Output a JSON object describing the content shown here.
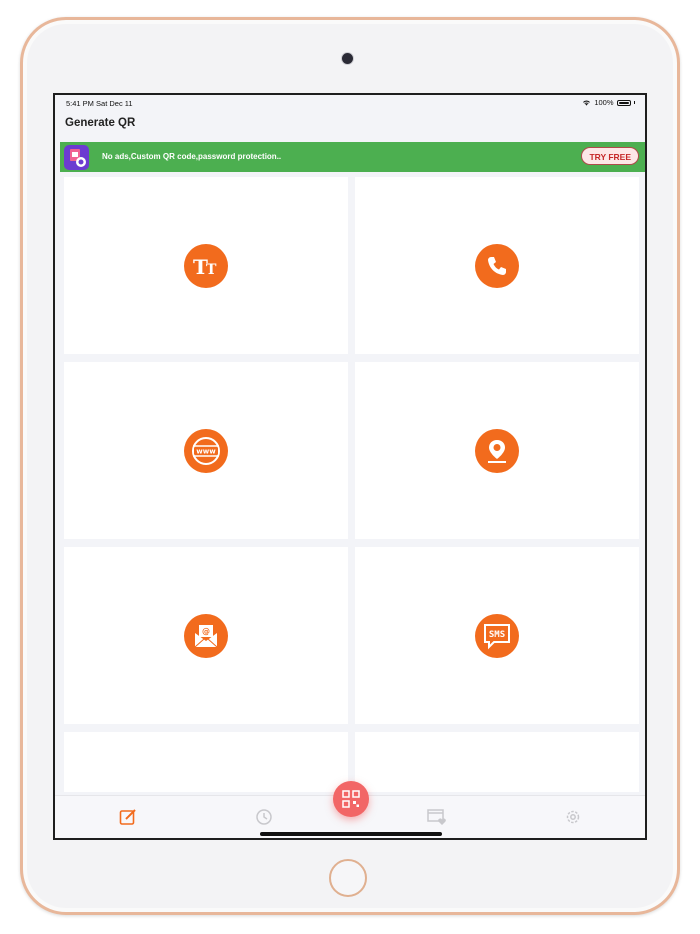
{
  "status": {
    "time_date": "5:41 PM   Sat Dec 11",
    "battery": "100%"
  },
  "header": {
    "title": "Generate QR"
  },
  "promo": {
    "text": "No ads,Custom QR code,password protection..",
    "button": "TRY FREE"
  },
  "grid": {
    "items": [
      {
        "icon": "text-icon",
        "label": "Tт"
      },
      {
        "icon": "phone-icon"
      },
      {
        "icon": "website-icon",
        "label": "www"
      },
      {
        "icon": "location-icon"
      },
      {
        "icon": "email-icon"
      },
      {
        "icon": "sms-icon",
        "label": "SMS"
      }
    ]
  },
  "tabbar": {
    "tabs": [
      "create-icon",
      "history-icon",
      "qr-scan-icon",
      "favorites-icon",
      "settings-icon"
    ],
    "active": "create-icon"
  },
  "colors": {
    "accent": "#f26b1d",
    "promo": "#4caf50",
    "fab": "#f26666"
  }
}
